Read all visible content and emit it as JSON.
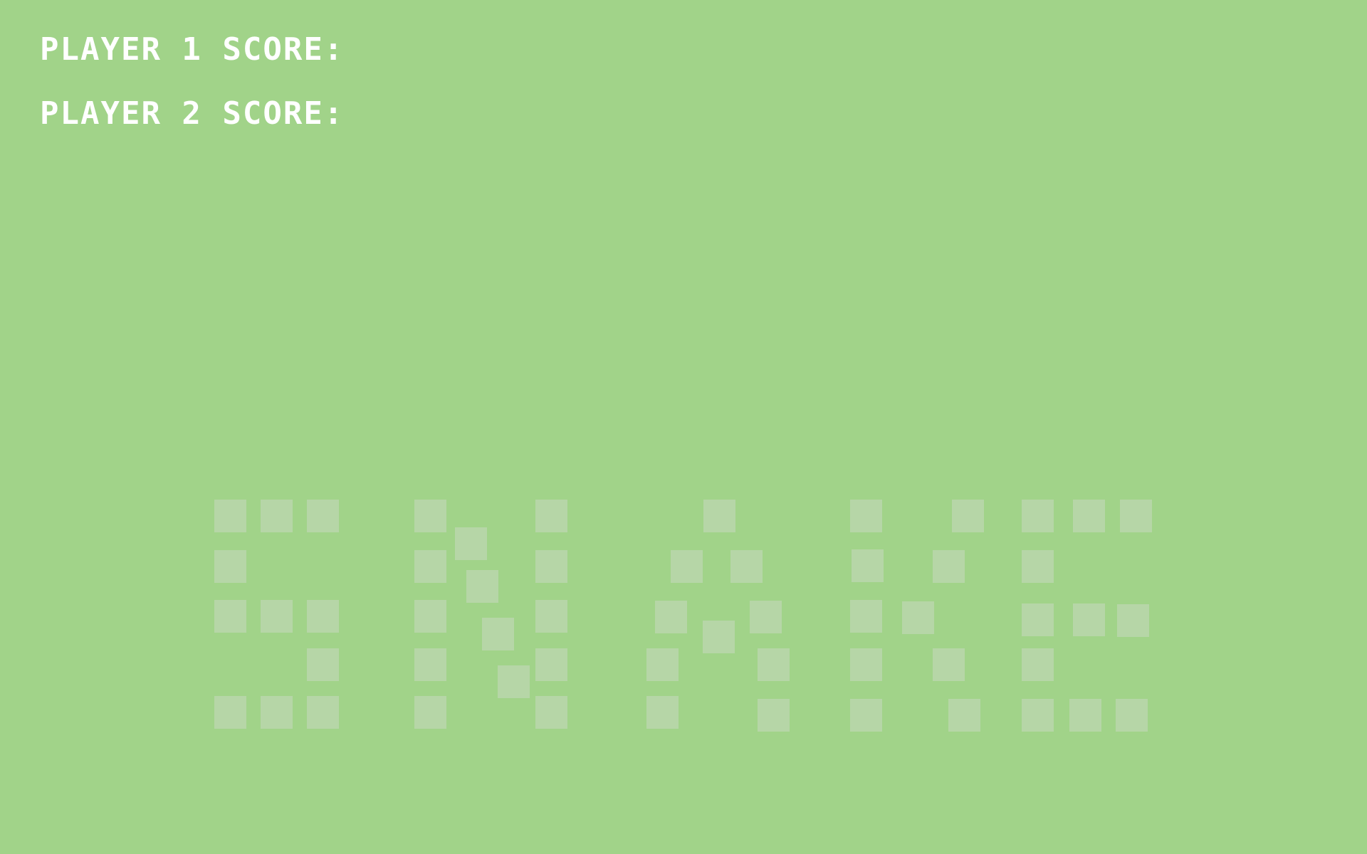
{
  "hud": {
    "player1_label": "PLAYER 1 SCORE:",
    "player1_score": "",
    "player2_label": "PLAYER 2 SCORE:",
    "player2_score": ""
  },
  "title": {
    "word": "SNAKE"
  },
  "colors": {
    "background": "#a1d389",
    "hud_text": "#ffffff",
    "title_blocks": "#b6d6a7"
  }
}
